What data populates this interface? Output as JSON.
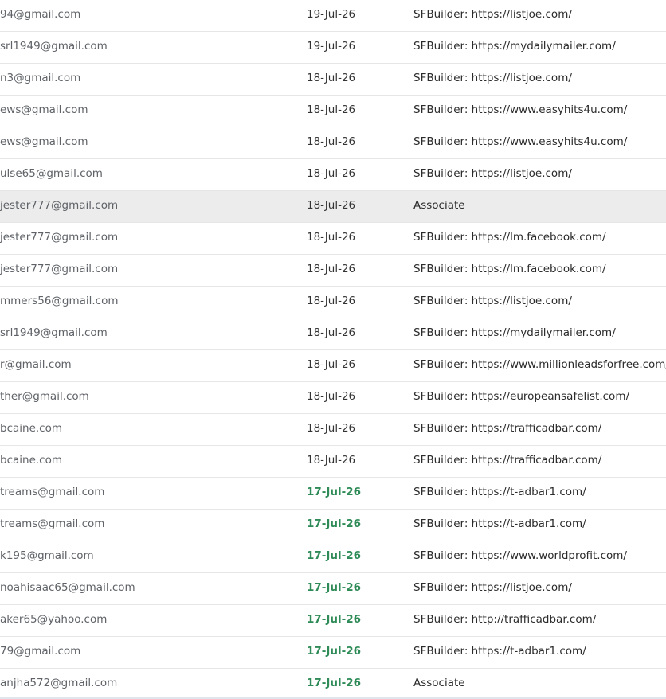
{
  "rows": [
    {
      "email": "94@gmail.com",
      "date": "19-Jul-26",
      "source": "SFBuilder: https://listjoe.com/",
      "recent": false,
      "highlight": false
    },
    {
      "email": "srl1949@gmail.com",
      "date": "19-Jul-26",
      "source": "SFBuilder: https://mydailymailer.com/",
      "recent": false,
      "highlight": false
    },
    {
      "email": "n3@gmail.com",
      "date": "18-Jul-26",
      "source": "SFBuilder: https://listjoe.com/",
      "recent": false,
      "highlight": false
    },
    {
      "email": "ews@gmail.com",
      "date": "18-Jul-26",
      "source": "SFBuilder: https://www.easyhits4u.com/",
      "recent": false,
      "highlight": false
    },
    {
      "email": "ews@gmail.com",
      "date": "18-Jul-26",
      "source": "SFBuilder: https://www.easyhits4u.com/",
      "recent": false,
      "highlight": false
    },
    {
      "email": "ulse65@gmail.com",
      "date": "18-Jul-26",
      "source": "SFBuilder: https://listjoe.com/",
      "recent": false,
      "highlight": false
    },
    {
      "email": "jester777@gmail.com",
      "date": "18-Jul-26",
      "source": "Associate",
      "recent": false,
      "highlight": true
    },
    {
      "email": "jester777@gmail.com",
      "date": "18-Jul-26",
      "source": "SFBuilder: https://lm.facebook.com/",
      "recent": false,
      "highlight": false
    },
    {
      "email": "jester777@gmail.com",
      "date": "18-Jul-26",
      "source": "SFBuilder: https://lm.facebook.com/",
      "recent": false,
      "highlight": false
    },
    {
      "email": "mmers56@gmail.com",
      "date": "18-Jul-26",
      "source": "SFBuilder: https://listjoe.com/",
      "recent": false,
      "highlight": false
    },
    {
      "email": "srl1949@gmail.com",
      "date": "18-Jul-26",
      "source": "SFBuilder: https://mydailymailer.com/",
      "recent": false,
      "highlight": false
    },
    {
      "email": "r@gmail.com",
      "date": "18-Jul-26",
      "source": "SFBuilder: https://www.millionleadsforfree.com/",
      "recent": false,
      "highlight": false
    },
    {
      "email": "ther@gmail.com",
      "date": "18-Jul-26",
      "source": "SFBuilder: https://europeansafelist.com/",
      "recent": false,
      "highlight": false
    },
    {
      "email": "bcaine.com",
      "date": "18-Jul-26",
      "source": "SFBuilder: https://trafficadbar.com/",
      "recent": false,
      "highlight": false
    },
    {
      "email": "bcaine.com",
      "date": "18-Jul-26",
      "source": "SFBuilder: https://trafficadbar.com/",
      "recent": false,
      "highlight": false
    },
    {
      "email": "treams@gmail.com",
      "date": "17-Jul-26",
      "source": "SFBuilder: https://t-adbar1.com/",
      "recent": true,
      "highlight": false
    },
    {
      "email": "treams@gmail.com",
      "date": "17-Jul-26",
      "source": "SFBuilder: https://t-adbar1.com/",
      "recent": true,
      "highlight": false
    },
    {
      "email": "k195@gmail.com",
      "date": "17-Jul-26",
      "source": "SFBuilder: https://www.worldprofit.com/",
      "recent": true,
      "highlight": false
    },
    {
      "email": "noahisaac65@gmail.com",
      "date": "17-Jul-26",
      "source": "SFBuilder: https://listjoe.com/",
      "recent": true,
      "highlight": false
    },
    {
      "email": "aker65@yahoo.com",
      "date": "17-Jul-26",
      "source": "SFBuilder: http://trafficadbar.com/",
      "recent": true,
      "highlight": false
    },
    {
      "email": "79@gmail.com",
      "date": "17-Jul-26",
      "source": "SFBuilder: https://t-adbar1.com/",
      "recent": true,
      "highlight": false
    },
    {
      "email": "anjha572@gmail.com",
      "date": "17-Jul-26",
      "source": "Associate",
      "recent": true,
      "highlight": false
    }
  ]
}
